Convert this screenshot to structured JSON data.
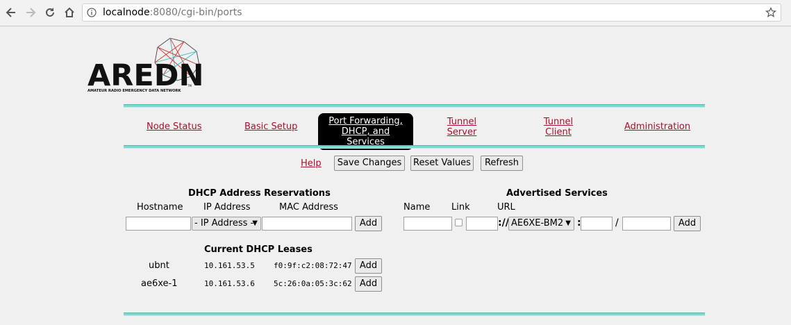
{
  "browser": {
    "url_host": "localnode",
    "url_rest": ":8080/cgi-bin/ports"
  },
  "logo": {
    "title": "AREDN",
    "tagline": "AMATEUR RADIO EMERGENCY DATA NETWORK",
    "tm": "TM"
  },
  "nav": {
    "node_status": "Node Status",
    "basic_setup": "Basic Setup",
    "port_forwarding_line1": "Port Forwarding,",
    "port_forwarding_line2": "DHCP, and Services",
    "tunnel_server_line1": "Tunnel",
    "tunnel_server_line2": "Server",
    "tunnel_client_line1": "Tunnel",
    "tunnel_client_line2": "Client",
    "administration": "Administration"
  },
  "toolbar": {
    "help": "Help",
    "save": "Save Changes",
    "reset": "Reset Values",
    "refresh": "Refresh"
  },
  "dhcp": {
    "title": "DHCP Address Reservations",
    "col_hostname": "Hostname",
    "col_ip": "IP Address",
    "col_mac": "MAC Address",
    "ip_select": "- IP Address -",
    "add": "Add"
  },
  "services": {
    "title": "Advertised Services",
    "col_name": "Name",
    "col_link": "Link",
    "col_url": "URL",
    "scheme_sep": "://",
    "host_select": "AE6XE-BM2",
    "port_sep": ":",
    "path_sep": "/",
    "add": "Add"
  },
  "leases": {
    "title": "Current DHCP Leases",
    "rows": [
      {
        "host": "ubnt",
        "ip": "10.161.53.5",
        "mac": "f0:9f:c2:08:72:47",
        "add": "Add"
      },
      {
        "host": "ae6xe-1",
        "ip": "10.161.53.6",
        "mac": "5c:26:0a:05:3c:62",
        "add": "Add"
      }
    ]
  },
  "colors": {
    "link": "#a8102b",
    "rule": "#7fd8d0",
    "active_tab_bg": "#000000"
  }
}
